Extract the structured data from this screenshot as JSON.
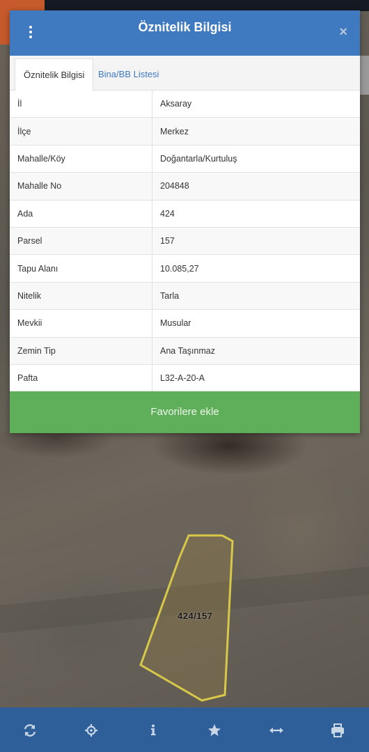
{
  "dialog": {
    "title": "Öznitelik Bilgisi",
    "close_label": "×"
  },
  "tabs": [
    {
      "label": "Öznitelik Bilgisi",
      "active": true
    },
    {
      "label": "Bina/BB Listesi",
      "active": false
    }
  ],
  "attributes": [
    {
      "key": "İl",
      "value": "Aksaray"
    },
    {
      "key": "İlçe",
      "value": "Merkez"
    },
    {
      "key": "Mahalle/Köy",
      "value": "Doğantarla/Kurtuluş"
    },
    {
      "key": "Mahalle No",
      "value": "204848"
    },
    {
      "key": "Ada",
      "value": "424"
    },
    {
      "key": "Parsel",
      "value": "157"
    },
    {
      "key": "Tapu Alanı",
      "value": "10.085,27"
    },
    {
      "key": "Nitelik",
      "value": "Tarla"
    },
    {
      "key": "Mevkii",
      "value": "Musular"
    },
    {
      "key": "Zemin Tip",
      "value": "Ana Taşınmaz"
    },
    {
      "key": "Pafta",
      "value": "L32-A-20-A"
    }
  ],
  "favorite_button": "Favorilere ekle",
  "map": {
    "parcel_label": "424/157"
  },
  "toolbar": {
    "icons": [
      "refresh-icon",
      "locate-icon",
      "info-icon",
      "star-icon",
      "measure-icon",
      "print-icon"
    ]
  },
  "colors": {
    "header": "#3f79c0",
    "favorite": "#5fae5a",
    "toolbar": "#2e5f99",
    "parcel_outline": "#d8c84a"
  }
}
